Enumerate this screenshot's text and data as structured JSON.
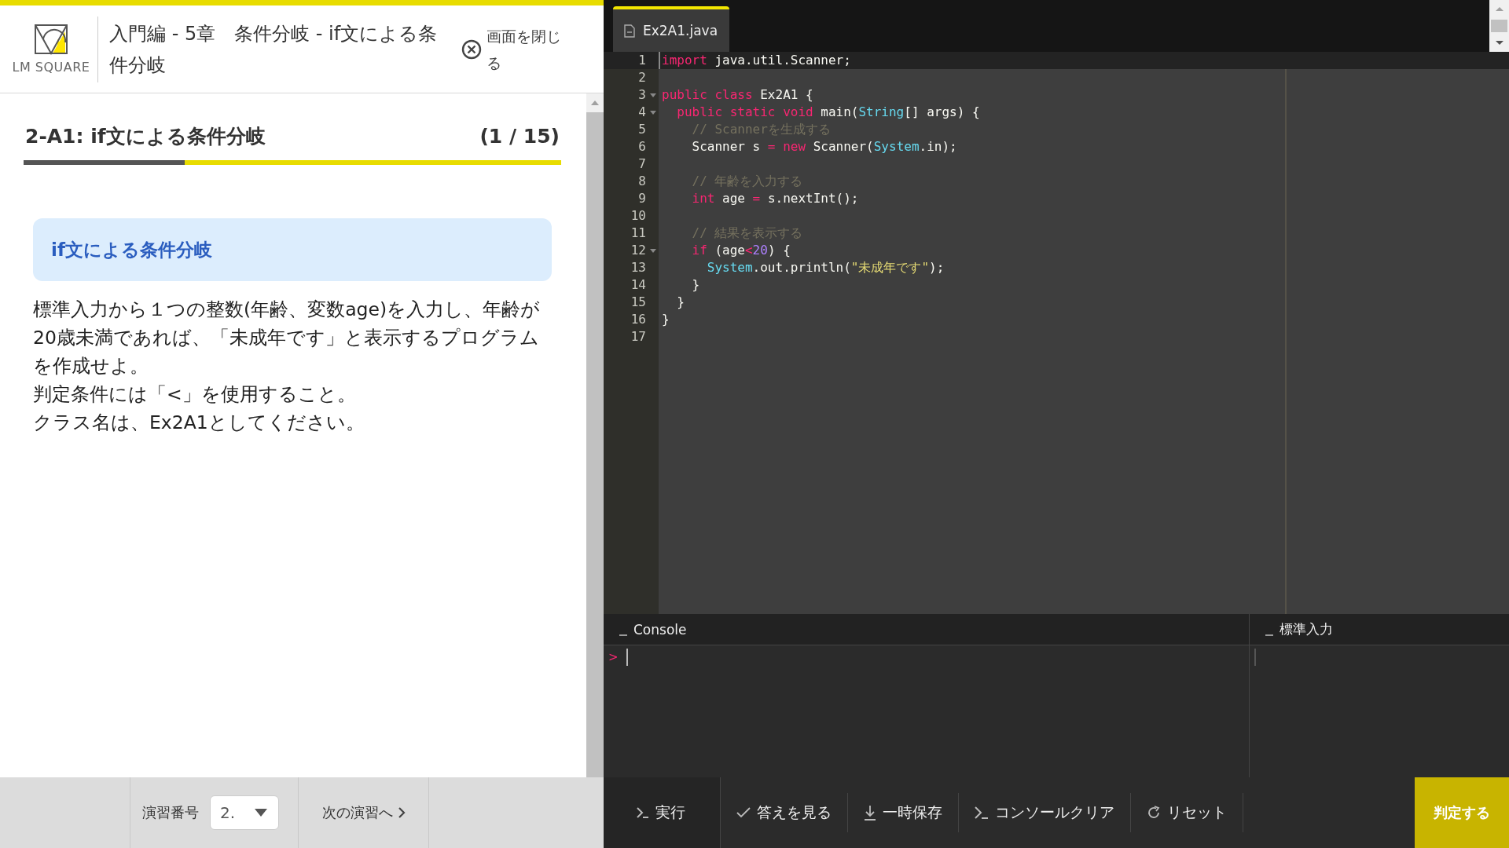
{
  "header": {
    "logo": "LM SQUARE",
    "title": "入門編 - 5章　条件分岐 - if文による条件分岐",
    "close": "画面を閉じる"
  },
  "exercise": {
    "title": "2-A1: if文による条件分岐",
    "count": "(1 / 15)",
    "level": 0.3,
    "box_heading": "if文による条件分岐",
    "paragraphs": [
      "標準入力から１つの整数(年齢、変数age)を入力し、年齢が20歳未満であれば、「未成年です」と表示するプログラムを作成せよ。",
      "判定条件には「<」を使用すること。",
      "クラス名は、Ex2A1としてください。"
    ]
  },
  "footer_left": {
    "label": "演習番号",
    "select_value": "2.",
    "next": "次の演習へ"
  },
  "editor": {
    "tabs": [
      {
        "label": "Ex2A1.java",
        "selected": true
      }
    ],
    "lines": [
      {
        "n": "1",
        "active": true,
        "foldable": false,
        "tokens": [
          {
            "kind": "kw",
            "text": "import"
          },
          {
            "kind": "plain",
            "text": " java.util.Scanner;"
          }
        ]
      },
      {
        "n": "2",
        "active": false,
        "foldable": false
      },
      {
        "n": "3",
        "active": false,
        "foldable": true,
        "tokens": [
          {
            "kind": "kw",
            "text": "public class"
          },
          {
            "kind": "plain",
            "text": " Ex2A1 {"
          }
        ]
      },
      {
        "n": "4",
        "active": false,
        "foldable": true,
        "tokens": [
          {
            "kind": "kw",
            "text": "  public static void"
          },
          {
            "kind": "plain",
            "text": " main("
          },
          {
            "kind": "type",
            "text": "String"
          },
          {
            "kind": "plain",
            "text": "[] args) {"
          }
        ]
      },
      {
        "n": "5",
        "active": false,
        "foldable": false,
        "tokens": [
          {
            "kind": "comment",
            "text": "    // Scannerを生成する"
          }
        ]
      },
      {
        "n": "6",
        "active": false,
        "foldable": false,
        "tokens": [
          {
            "kind": "plain",
            "text": "    Scanner s "
          },
          {
            "kind": "op",
            "text": "="
          },
          {
            "kind": "kw",
            "text": " new"
          },
          {
            "kind": "plain",
            "text": " Scanner("
          },
          {
            "kind": "type",
            "text": "System"
          },
          {
            "kind": "plain",
            "text": ".in);"
          }
        ]
      },
      {
        "n": "7",
        "active": false,
        "foldable": false
      },
      {
        "n": "8",
        "active": false,
        "foldable": false,
        "tokens": [
          {
            "kind": "comment",
            "text": "    // 年齢を入力する"
          }
        ]
      },
      {
        "n": "9",
        "active": false,
        "foldable": false,
        "tokens": [
          {
            "kind": "kw",
            "text": "    int"
          },
          {
            "kind": "plain",
            "text": " age "
          },
          {
            "kind": "op",
            "text": "="
          },
          {
            "kind": "plain",
            "text": " s.nextInt();"
          }
        ]
      },
      {
        "n": "10",
        "active": false,
        "foldable": false
      },
      {
        "n": "11",
        "active": false,
        "foldable": false,
        "tokens": [
          {
            "kind": "comment",
            "text": "    // 結果を表示する"
          }
        ]
      },
      {
        "n": "12",
        "active": false,
        "foldable": true,
        "tokens": [
          {
            "kind": "kw",
            "text": "    if"
          },
          {
            "kind": "plain",
            "text": " (age"
          },
          {
            "kind": "op",
            "text": "<"
          },
          {
            "kind": "num",
            "text": "20"
          },
          {
            "kind": "plain",
            "text": ") {"
          }
        ]
      },
      {
        "n": "13",
        "active": false,
        "foldable": false,
        "tokens": [
          {
            "kind": "type",
            "text": "      System"
          },
          {
            "kind": "plain",
            "text": ".out.println("
          },
          {
            "kind": "str",
            "text": "\"未成年です\""
          },
          {
            "kind": "plain",
            "text": ");"
          }
        ]
      },
      {
        "n": "14",
        "active": false,
        "foldable": false,
        "tokens": [
          {
            "kind": "plain",
            "text": "    }"
          }
        ]
      },
      {
        "n": "15",
        "active": false,
        "foldable": false,
        "tokens": [
          {
            "kind": "plain",
            "text": "  }"
          }
        ]
      },
      {
        "n": "16",
        "active": false,
        "foldable": false,
        "tokens": [
          {
            "kind": "plain",
            "text": "}"
          }
        ]
      },
      {
        "n": "17",
        "active": false,
        "foldable": false
      }
    ]
  },
  "console": {
    "title": "Console",
    "prompt": ">"
  },
  "stdin": {
    "title": "標準入力"
  },
  "toolbar": {
    "buttons": [
      {
        "label": "実行",
        "kind": "run"
      },
      {
        "label": "答えを見る",
        "kind": "answer"
      },
      {
        "label": "一時保存",
        "kind": "save"
      },
      {
        "label": "コンソールクリア",
        "kind": "clear"
      },
      {
        "label": "リセット",
        "kind": "reset"
      }
    ],
    "submit": "判定する"
  }
}
